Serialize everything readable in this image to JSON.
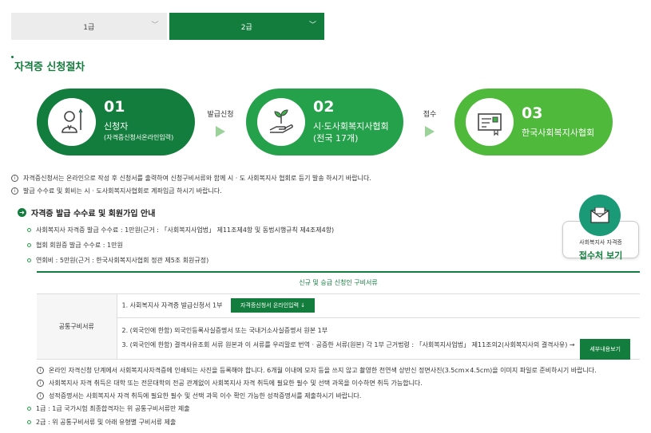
{
  "tabs": [
    {
      "label": "1급"
    },
    {
      "label": "2급"
    }
  ],
  "section_title": "자격증 신청절차",
  "steps": [
    {
      "num": "01",
      "label": "신청자",
      "sub": "(자격증신청서온라인입력)"
    },
    {
      "num": "02",
      "label": "시·도사회복지사협회",
      "sub": "(전국 17개)"
    },
    {
      "num": "03",
      "label": "한국사회복지사협회",
      "sub": ""
    }
  ],
  "arrows": [
    "발급신청",
    "접수"
  ],
  "notes_top": [
    "자격증신청서는 온라인으로 작성 후 신청서를 출력하여 신청구비서류와 함께 시 · 도 사회복지사 협회로 등기 발송 하시기 바랍니다.",
    "발급 수수료 및 회비는 시 · 도사회복지사협회로 계좌입금 하시기 바랍니다."
  ],
  "fee_heading": "자격증 발급 수수료 및 회원가입 안내",
  "fee_items": [
    "사회복지사 자격증 발급 수수료 : 1만원(근거 : 「사회복지사업법」 제11조제4항 및 동법시행규칙 제4조제4항)",
    "협회 회원증 발급 수수료 : 1만원",
    "연회비 : 5만원(근거 : 한국사회복지사협회 정관 제5조 회원규정)"
  ],
  "badge": {
    "line1": "사회복지사 자격증",
    "line2": "접수처 보기"
  },
  "table": {
    "header": "신규 및 승급 신청인 구비서류",
    "row_label": "공통구비서류",
    "row1_text": "1. 사회복지사 자격증 발급신청서 1부",
    "row1_button": "자격증신청서 온라인입력 ↓",
    "row2_line1": "2. (외국인에 한함) 외국인등록사실증명서 또는 국내거소사실증명서 원본 1부",
    "row2_line2": "3. (외국인에 한함) 결격사유조회 서류 원본과 이 서류를 우리말로 번역 · 공증한 서류(원본) 각 1부   근거법령 : 「사회복지사업법」 제11조의2(사회복지사의 결격사유) →",
    "row2_button": "세부내용보기"
  },
  "notes_bottom": [
    "온라인 자격신청 단계에서 사회복지사자격증에 인쇄되는 사진을 등록해야 합니다. 6개월 이내에 모자 등을 쓰지 않고 촬영한 천연색 상반신 정면사진(3.5cm×4.5cm)을 이미지 파일로 준비하시기 바랍니다.",
    "사회복지사 자격 취득은 대학 또는 전문대학의 전공 관계없이 사회복지사 자격 취득에 필요한 필수 및 선택 과목을 이수하면 취득 가능합니다.",
    "성적증명서는 사회복지사 자격 취득에 필요한 필수 및 선택 과목 이수 확인 가능한 성적증명서를 제출하시기 바랍니다."
  ],
  "grade_items": [
    "1급 : 1급 국가시험 최종합격자는 위 공통구비서류만 제출",
    "2급 : 위 공통구비서류 및 아래 유형별 구비서류 제출"
  ],
  "colors": {
    "primary": "#127d3c",
    "mid": "#24a14a",
    "light": "#4fb93b"
  }
}
